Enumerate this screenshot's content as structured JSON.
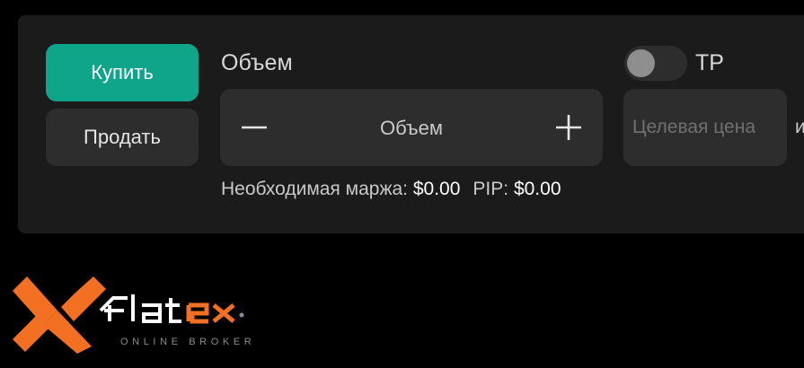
{
  "trade": {
    "buy_label": "Купить",
    "sell_label": "Продать",
    "volume_label": "Объем",
    "volume_placeholder": "Объем",
    "margin_label": "Необходимая маржа:",
    "margin_value": "$0.00",
    "pip_label": "PIP:",
    "pip_value": "$0.00",
    "tp_label": "TP",
    "tp_enabled": false,
    "target_price_placeholder": "Целевая цена",
    "overflow_text": "и"
  },
  "brand": {
    "logo_subtitle": "ONLINE BROKER",
    "logo_wordmark": "flatex",
    "accent_color": "#f36f21",
    "buy_color": "#0ea58a"
  }
}
